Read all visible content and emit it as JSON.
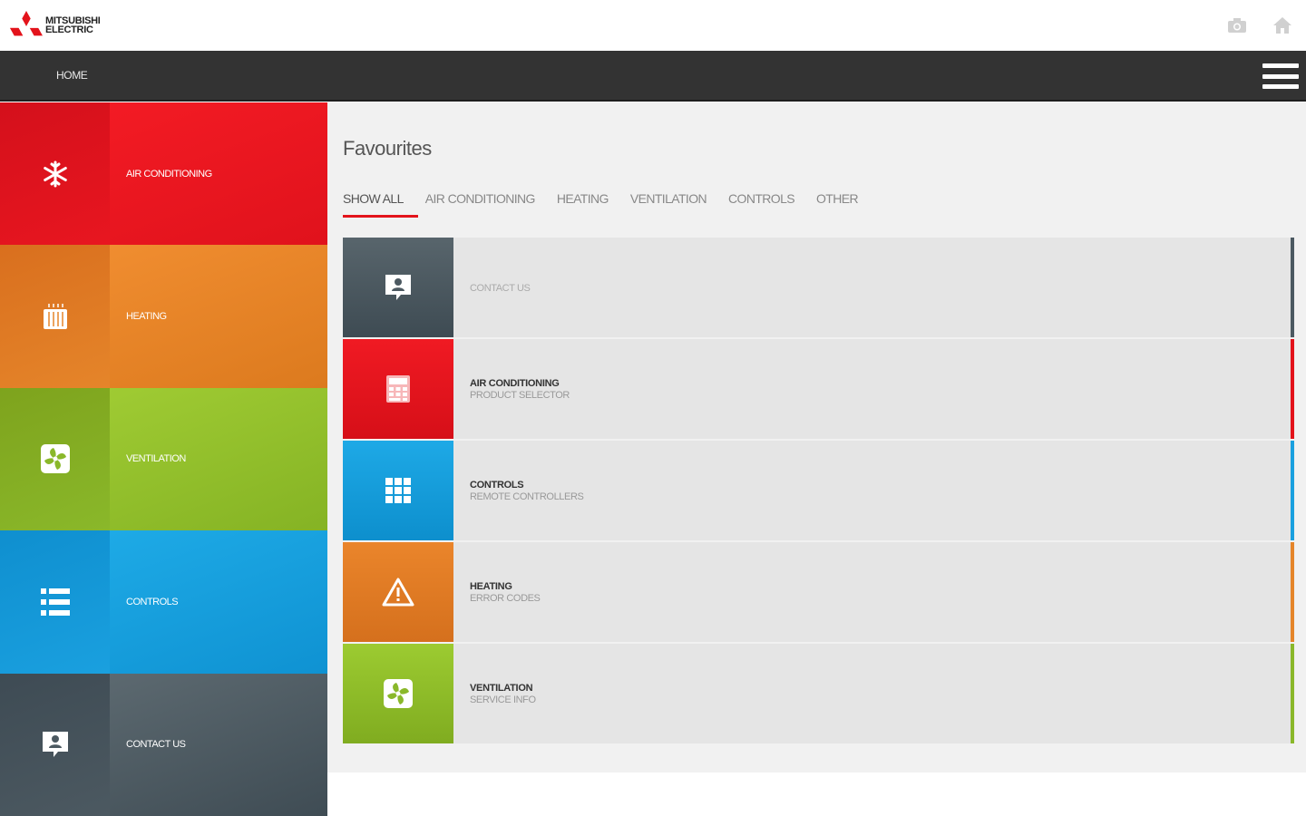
{
  "brand": {
    "line1": "MITSUBISHI",
    "line2": "ELECTRIC",
    "color": "#e3131b"
  },
  "topbar": {
    "icons": [
      "camera-icon",
      "home-icon"
    ]
  },
  "nav": {
    "home_label": "HOME",
    "menu_icon": "hamburger-menu-icon"
  },
  "sidebar": {
    "items": [
      {
        "label": "AIR CONDITIONING",
        "icon": "snowflake-icon",
        "color": "#e81620"
      },
      {
        "label": "HEATING",
        "icon": "radiator-icon",
        "color": "#e5852a"
      },
      {
        "label": "VENTILATION",
        "icon": "fan-icon",
        "color": "#8ab82a"
      },
      {
        "label": "CONTROLS",
        "icon": "list-icon",
        "color": "#1aa0df"
      },
      {
        "label": "CONTACT US",
        "icon": "contact-chat-icon",
        "color": "#4c5961"
      }
    ]
  },
  "main": {
    "title": "Favourites",
    "tabs": [
      {
        "label": "SHOW ALL",
        "active": true
      },
      {
        "label": "AIR CONDITIONING"
      },
      {
        "label": "HEATING"
      },
      {
        "label": "VENTILATION"
      },
      {
        "label": "CONTROLS"
      },
      {
        "label": "OTHER"
      }
    ],
    "favourites": [
      {
        "title": "",
        "subtitle": "CONTACT US",
        "icon": "contact-chat-icon",
        "color": "#4c5961"
      },
      {
        "title": "AIR CONDITIONING",
        "subtitle": "PRODUCT SELECTOR",
        "icon": "calculator-icon",
        "color": "#e3131b"
      },
      {
        "title": "CONTROLS",
        "subtitle": "REMOTE CONTROLLERS",
        "icon": "grid-icon",
        "color": "#1aa0df"
      },
      {
        "title": "HEATING",
        "subtitle": "ERROR CODES",
        "icon": "warning-icon",
        "color": "#e5852a"
      },
      {
        "title": "VENTILATION",
        "subtitle": "SERVICE INFO",
        "icon": "fan-icon",
        "color": "#8ab82a"
      }
    ]
  }
}
